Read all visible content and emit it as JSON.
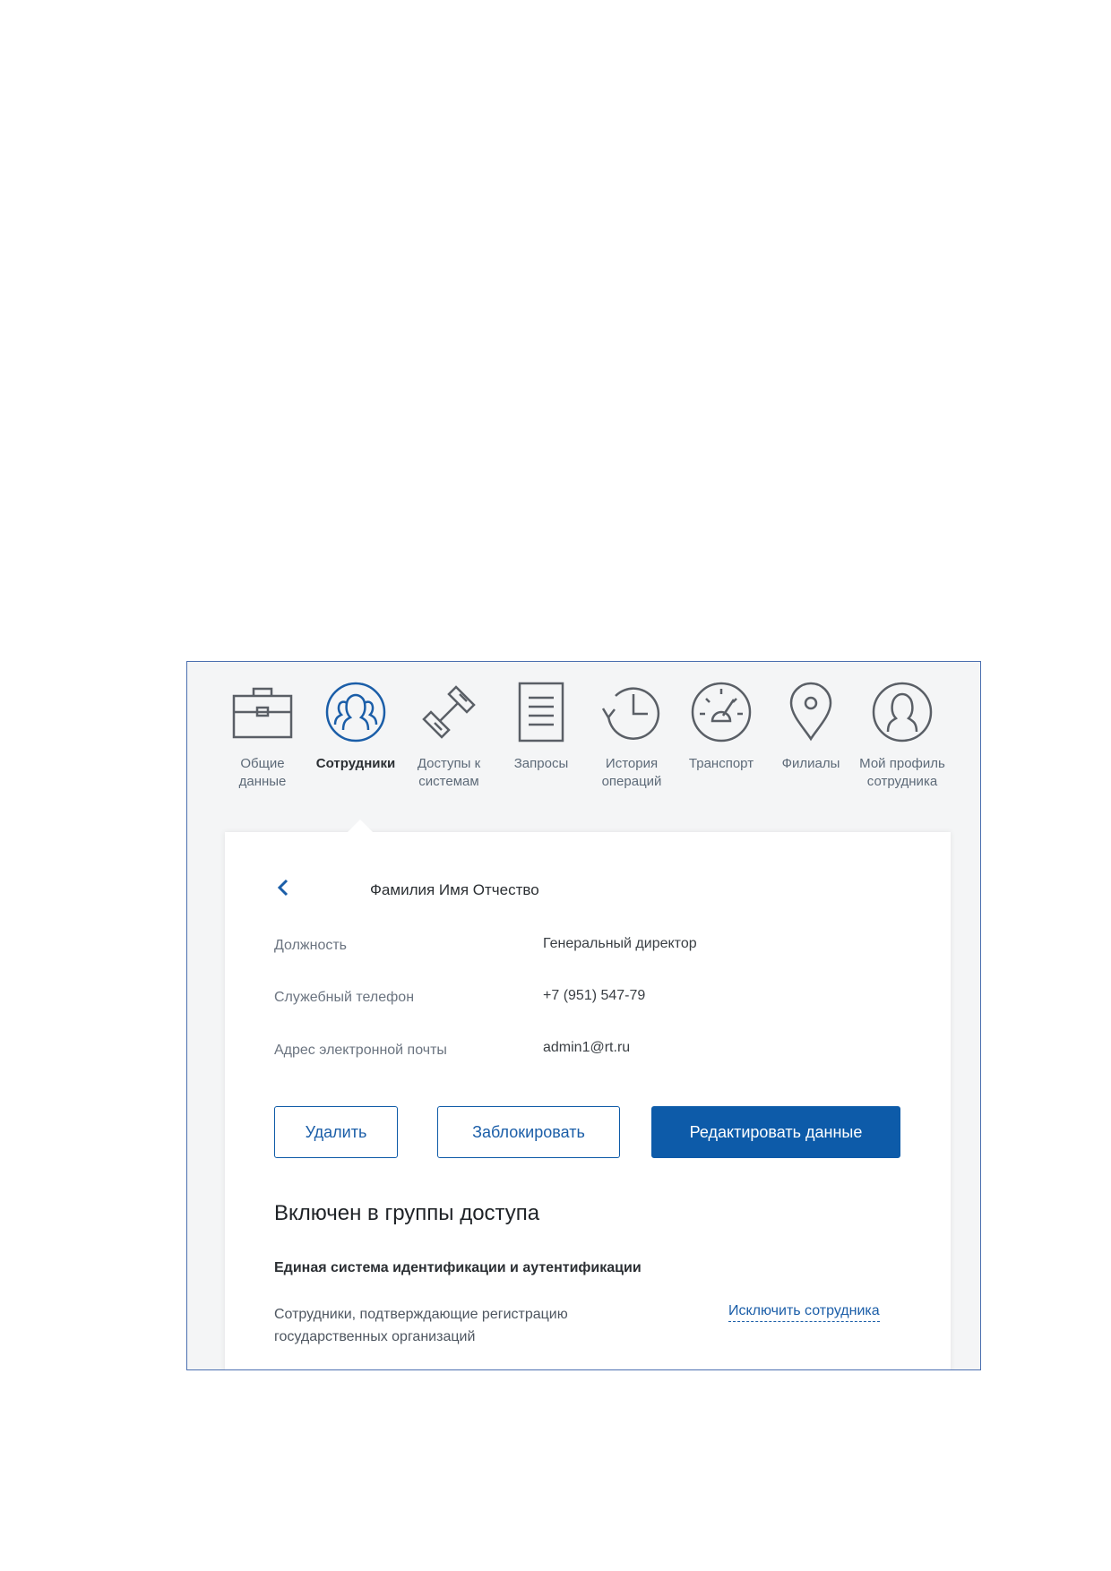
{
  "nav": {
    "items": [
      {
        "label": "Общие\nданные",
        "icon": "briefcase-icon",
        "active": false
      },
      {
        "label": "Сотрудники",
        "icon": "users-icon",
        "active": true
      },
      {
        "label": "Доступы к\nсистемам",
        "icon": "chain-link-icon",
        "active": false
      },
      {
        "label": "Запросы",
        "icon": "document-icon",
        "active": false
      },
      {
        "label": "История\nопераций",
        "icon": "history-icon",
        "active": false
      },
      {
        "label": "Транспорт",
        "icon": "speedometer-icon",
        "active": false
      },
      {
        "label": "Филиалы",
        "icon": "location-pin-icon",
        "active": false
      },
      {
        "label": "Мой профиль\nсотрудника",
        "icon": "user-profile-icon",
        "active": false
      }
    ]
  },
  "employee": {
    "name": "Фамилия Имя Отчество",
    "fields": [
      {
        "label": "Должность",
        "value": "Генеральный директор"
      },
      {
        "label": "Служебный телефон",
        "value": "+7 (951) 547-79"
      },
      {
        "label": "Адрес электронной почты",
        "value": "admin1@rt.ru"
      }
    ]
  },
  "actions": {
    "delete_label": "Удалить",
    "block_label": "Заблокировать",
    "edit_label": "Редактировать данные"
  },
  "groups": {
    "section_title": "Включен в группы доступа",
    "system_title": "Единая система идентификации и аутентификации",
    "group_description": "Сотрудники, подтверждающие регистрацию государственных организаций",
    "exclude_label": "Исключить сотрудника"
  },
  "colors": {
    "accent": "#0d5ba9",
    "active_icon": "#1b5ea8",
    "inactive_icon": "#5a5f66",
    "frame_border": "#4b6fb0"
  }
}
